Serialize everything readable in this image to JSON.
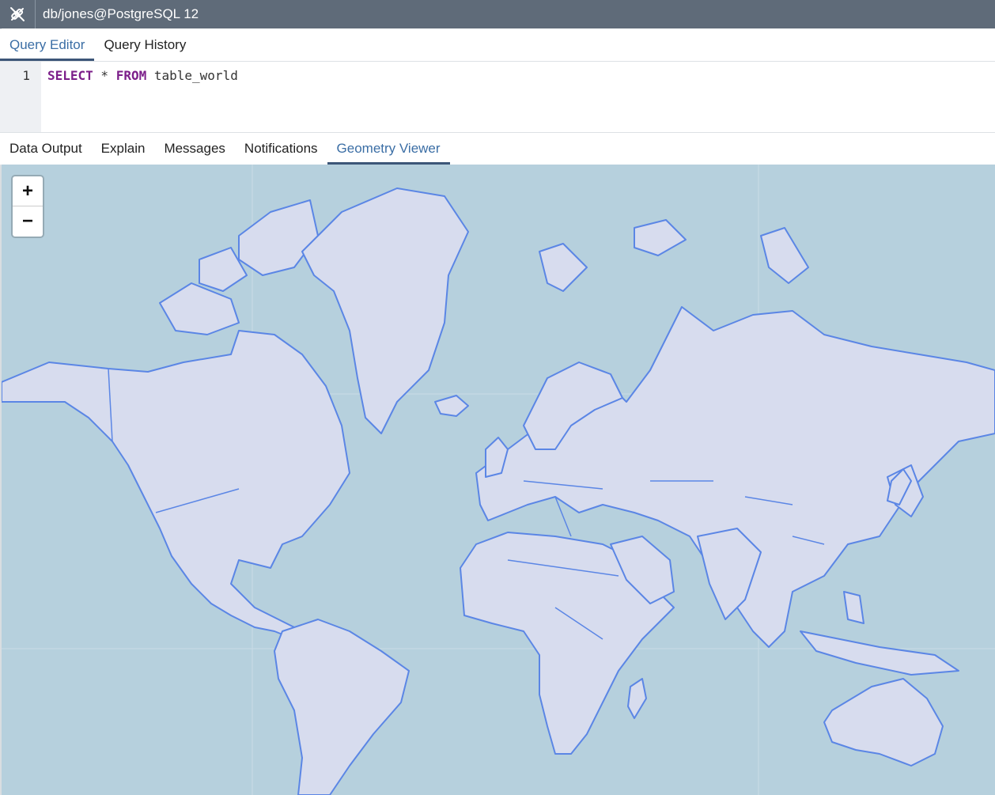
{
  "titlebar": {
    "title": "db/jones@PostgreSQL 12",
    "icon": "connection-icon"
  },
  "top_tabs": [
    {
      "label": "Query Editor",
      "active": true
    },
    {
      "label": "Query History",
      "active": false
    }
  ],
  "editor": {
    "line_number": "1",
    "kw1": "SELECT",
    "star": " * ",
    "kw2": "FROM",
    "rest": " table_world"
  },
  "bottom_tabs": [
    {
      "label": "Data Output",
      "active": false
    },
    {
      "label": "Explain",
      "active": false
    },
    {
      "label": "Messages",
      "active": false
    },
    {
      "label": "Notifications",
      "active": false
    },
    {
      "label": "Geometry Viewer",
      "active": true
    }
  ],
  "map": {
    "zoom_in": "+",
    "zoom_out": "−",
    "colors": {
      "ocean": "#b6d0dd",
      "land": "#d7dcee",
      "border": "#5b86e5"
    }
  }
}
